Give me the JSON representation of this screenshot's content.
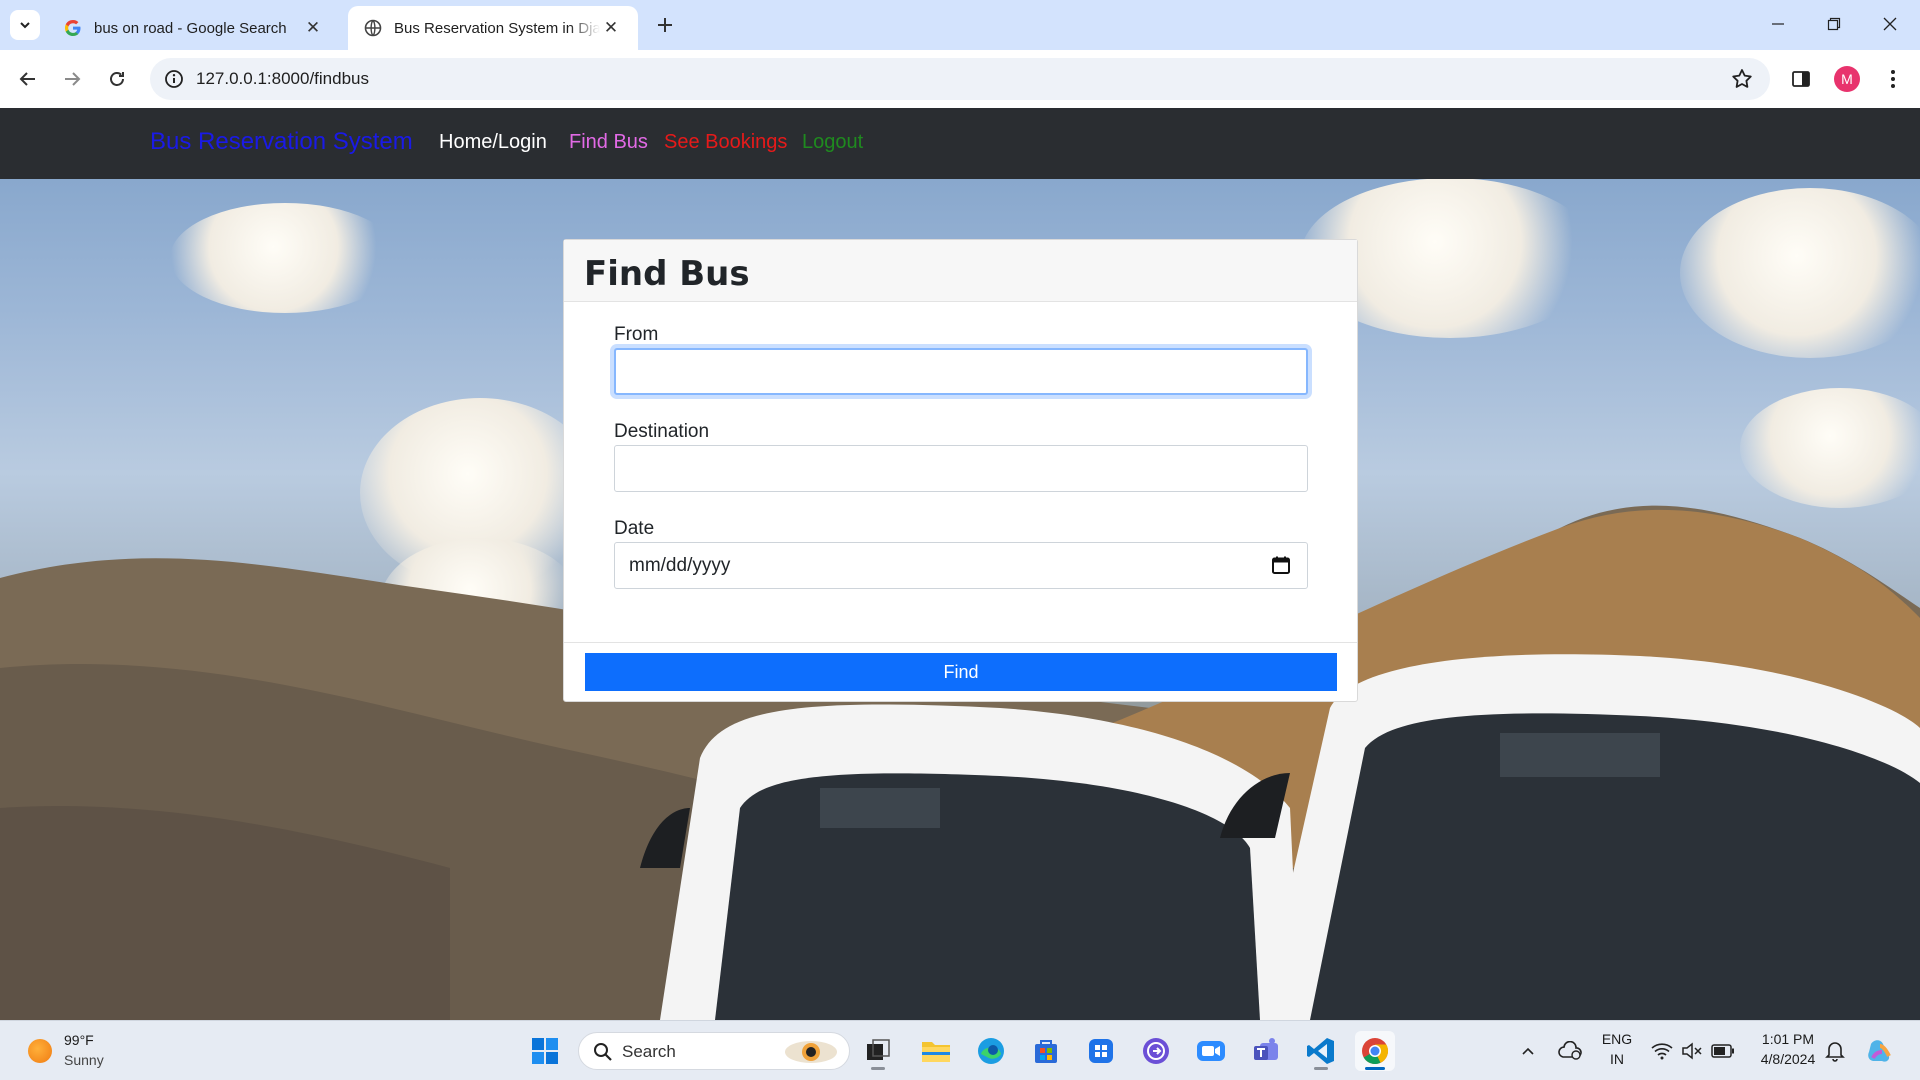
{
  "browser": {
    "tabs": [
      {
        "title": "bus on road - Google Search",
        "favicon": "google-icon",
        "active": false
      },
      {
        "title": "Bus Reservation System in Django",
        "favicon": "globe-icon",
        "active": true
      }
    ],
    "url": "127.0.0.1:8000/findbus",
    "profile_initial": "M",
    "profile_color": "#e8336d"
  },
  "navbar": {
    "brand": "Bus Reservation System",
    "links": [
      {
        "label": "Home/Login",
        "color": "#ffffff"
      },
      {
        "label": "Find Bus",
        "color": "#e26ae6"
      },
      {
        "label": "See Bookings",
        "color": "#e61a1a"
      },
      {
        "label": "Logout",
        "color": "#1f8a1f"
      }
    ]
  },
  "form": {
    "title": "Find Bus",
    "fields": [
      {
        "label": "From",
        "value": "",
        "focused": true
      },
      {
        "label": "Destination",
        "value": ""
      },
      {
        "label": "Date",
        "placeholder": "mm/dd/yyyy"
      }
    ],
    "submit_label": "Find",
    "accent": "#0d6efd"
  },
  "taskbar": {
    "weather": {
      "temp": "99°F",
      "condition": "Sunny"
    },
    "search_label": "Search",
    "language": {
      "line1": "ENG",
      "line2": "IN"
    },
    "clock": {
      "time": "1:01 PM",
      "date": "4/8/2024"
    }
  }
}
